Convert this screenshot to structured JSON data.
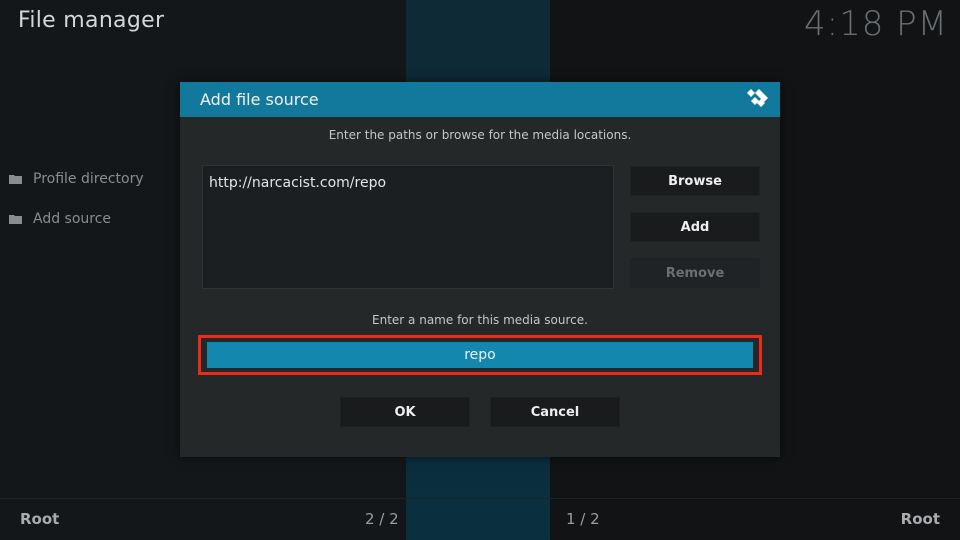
{
  "app": {
    "title": "File manager",
    "clock": "4:18 PM"
  },
  "sidebar": {
    "items": [
      {
        "label": "Profile directory",
        "icon": "folder-icon"
      },
      {
        "label": "Add source",
        "icon": "folder-icon"
      }
    ]
  },
  "footer": {
    "left_label": "Root",
    "left_count": "2 / 2",
    "right_count": "1 / 2",
    "right_label": "Root"
  },
  "dialog": {
    "title": "Add file source",
    "logo_icon": "kodi-logo-icon",
    "paths_hint": "Enter the paths or browse for the media locations.",
    "paths": [
      "http://narcacist.com/repo"
    ],
    "browse_label": "Browse",
    "add_label": "Add",
    "remove_label": "Remove",
    "name_hint": "Enter a name for this media source.",
    "name_value": "repo",
    "ok_label": "OK",
    "cancel_label": "Cancel"
  },
  "colors": {
    "header": "#12799c",
    "focused_field": "#1387ad",
    "highlight_border": "#ee2a1a",
    "dialog_bg": "#242829"
  }
}
